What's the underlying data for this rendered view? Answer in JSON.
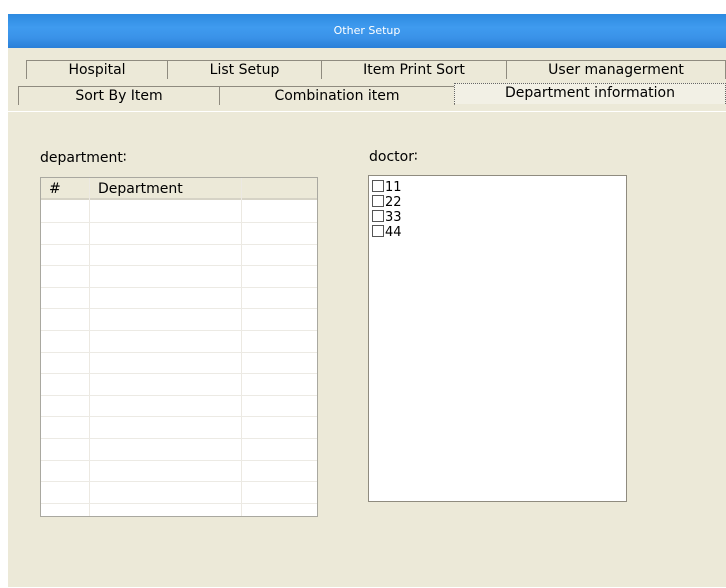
{
  "window": {
    "title": "Other Setup"
  },
  "tabs_row1": [
    "Hospital",
    "List Setup",
    "Item Print Sort",
    "User managerment"
  ],
  "tabs_row2": [
    "Sort By Item",
    "Combination item",
    "Department information"
  ],
  "active_tab": "Department information",
  "department": {
    "label": "department∶",
    "columns": [
      "#",
      "Department",
      ""
    ],
    "rows": []
  },
  "doctor": {
    "label": "doctor∶",
    "items": [
      {
        "label": "11",
        "checked": false
      },
      {
        "label": "22",
        "checked": false
      },
      {
        "label": "33",
        "checked": false
      },
      {
        "label": "44",
        "checked": false
      }
    ]
  }
}
